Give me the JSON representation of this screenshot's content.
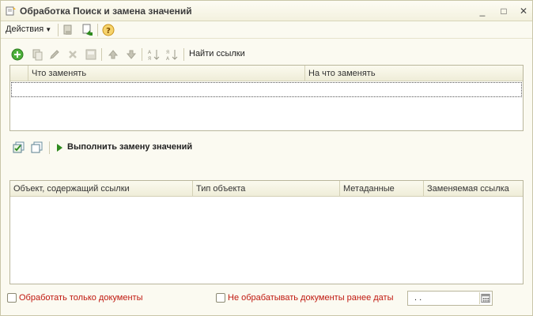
{
  "window": {
    "title": "Обработка  Поиск и замена значений",
    "minimize_glyph": "_",
    "maximize_glyph": "□",
    "close_glyph": "✕"
  },
  "toolbar": {
    "actions_label": "Действия",
    "help_glyph": "?"
  },
  "replace_table": {
    "find_refs_label": "Найти ссылки",
    "columns": [
      "Что заменять",
      "На что заменять"
    ]
  },
  "execute": {
    "label": "Выполнить замену значений"
  },
  "refs_table": {
    "columns": [
      "Объект, содержащий ссылки",
      "Тип объекта",
      "Метаданные",
      "Заменяемая ссылка"
    ]
  },
  "options": {
    "only_documents_label": "Обработать только документы",
    "skip_before_date_label": "Не обрабатывать документы ранее даты",
    "date_value": ". ."
  },
  "colors": {
    "accent_red": "#c0180f",
    "play_green": "#2e8a1e",
    "window_bg": "#fbfaf1"
  }
}
